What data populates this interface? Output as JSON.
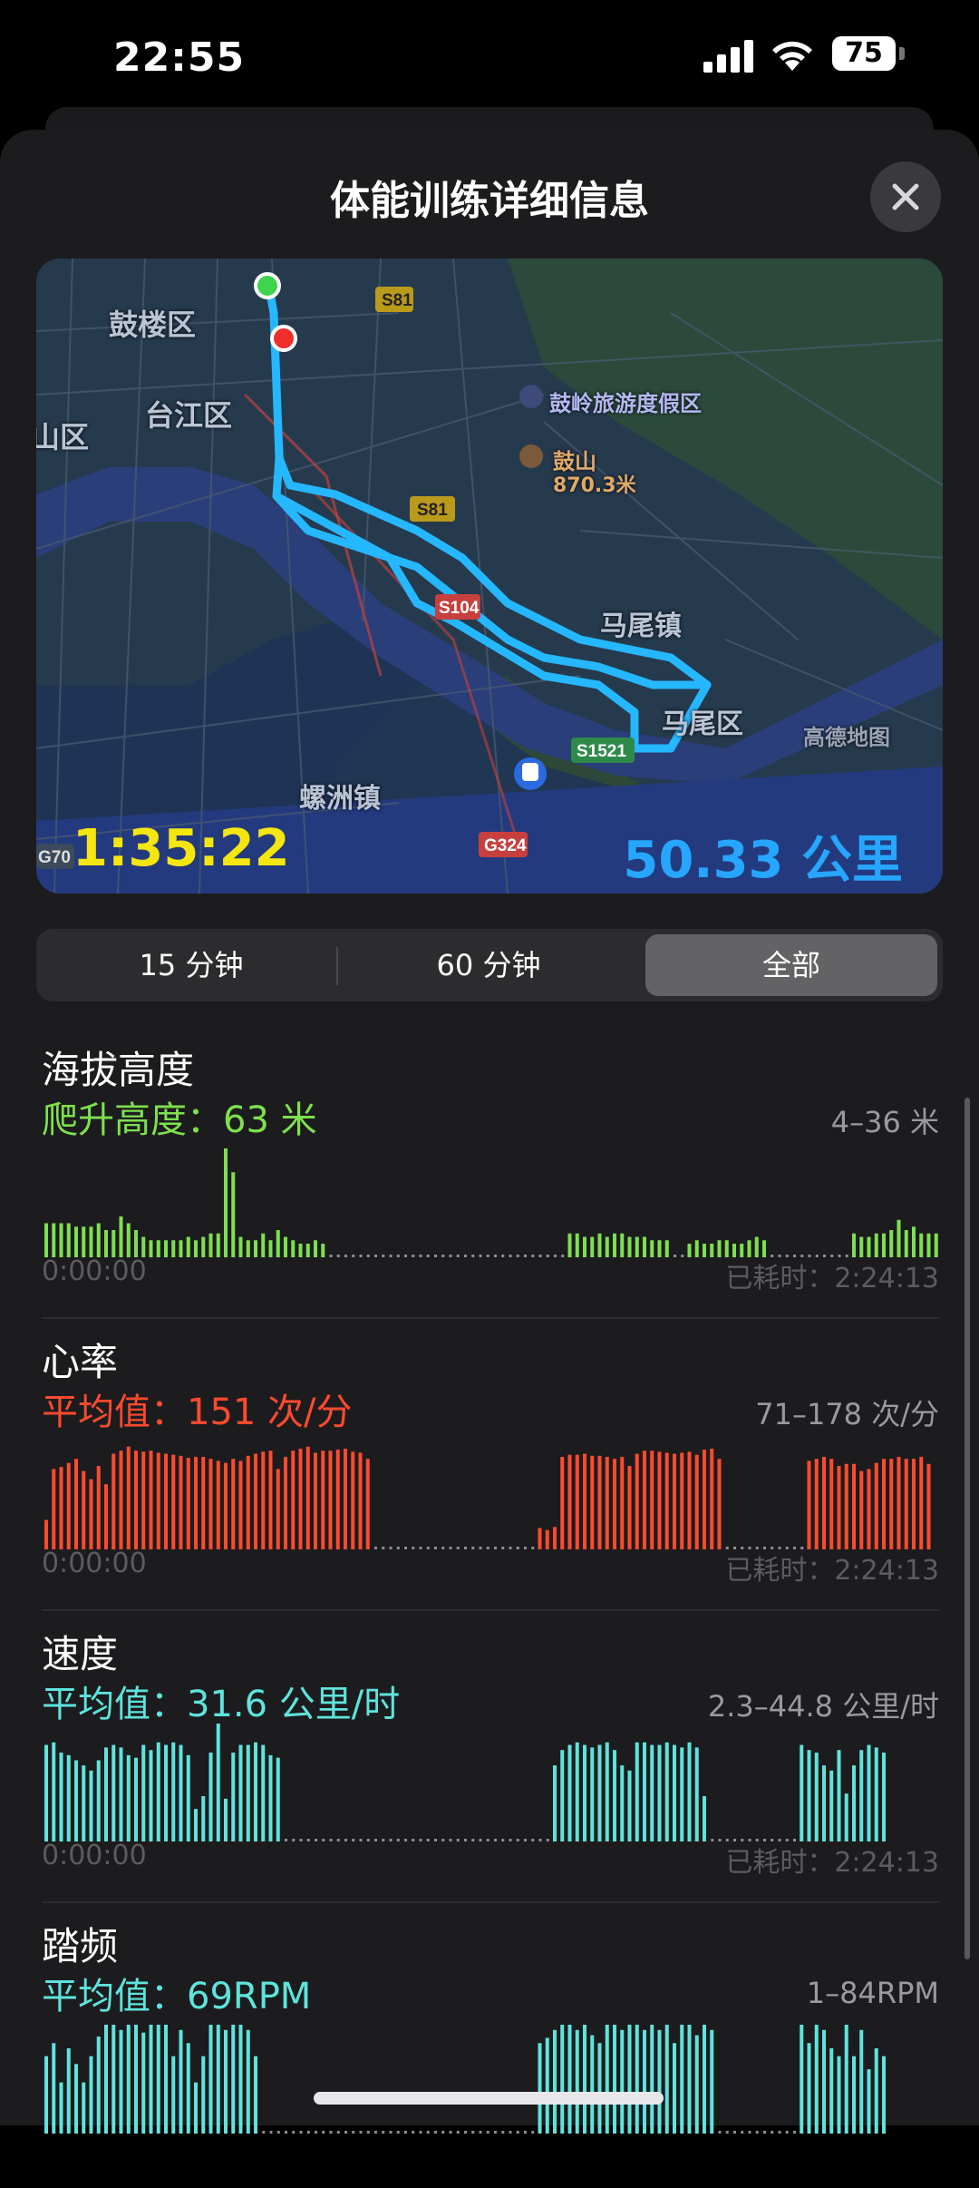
{
  "status_bar": {
    "time": "22:55",
    "battery": "75"
  },
  "sheet": {
    "title": "体能训练详细信息"
  },
  "map": {
    "labels": [
      {
        "text": "鼓楼区"
      },
      {
        "text": "台江区"
      },
      {
        "text": "山区"
      },
      {
        "text": "鼓岭旅游度假区"
      },
      {
        "text": "鼓山"
      },
      {
        "text": "870.3米"
      },
      {
        "text": "马尾镇"
      },
      {
        "text": "马尾区"
      },
      {
        "text": "螺洲镇"
      },
      {
        "text": "高德地图"
      }
    ],
    "road_badges": [
      "S81",
      "S81",
      "S104",
      "S1521",
      "G324",
      "G70"
    ],
    "duration": "1:35:22",
    "distance": "50.33 公里"
  },
  "segments": {
    "items": [
      "15 分钟",
      "60 分钟",
      "全部"
    ],
    "selected": "全部"
  },
  "metrics": [
    {
      "title": "海拔高度",
      "value": "爬升高度：63 米",
      "range": "4–36 米",
      "start": "0:00:00",
      "end": "已耗时：2:24:13",
      "color": "#7ee04e"
    },
    {
      "title": "心率",
      "value": "平均值：151 次/分",
      "range": "71–178 次/分",
      "start": "0:00:00",
      "end": "已耗时：2:24:13",
      "color": "#ff4a2e"
    },
    {
      "title": "速度",
      "value": "平均值：31.6 公里/时",
      "range": "2.3–44.8 公里/时",
      "start": "0:00:00",
      "end": "已耗时：2:24:13",
      "color": "#5ee4dc"
    },
    {
      "title": "踏频",
      "value": "平均值：69RPM",
      "range": "1–84RPM",
      "color": "#5ee4dc"
    }
  ],
  "chart_data": [
    {
      "type": "bar",
      "title": "海拔高度",
      "ylim": [
        4,
        36
      ],
      "segments": [
        {
          "from": 0,
          "values": [
            14,
            14,
            14,
            14,
            13,
            13,
            13,
            14,
            12,
            12,
            16,
            14,
            12,
            10,
            9,
            9,
            9,
            9,
            9,
            10,
            9,
            10,
            11,
            11,
            36,
            29,
            10,
            9,
            9,
            11,
            9,
            12,
            10,
            9,
            8,
            8,
            9,
            8
          ]
        },
        {
          "dots_to": 70
        },
        {
          "from": 70,
          "values": [
            11,
            11,
            10,
            10,
            11,
            10,
            11,
            11,
            10,
            10,
            10,
            9,
            9,
            9
          ]
        },
        {
          "dots_to": 86
        },
        {
          "from": 86,
          "values": [
            8,
            9,
            8,
            8,
            9,
            9,
            8,
            8,
            9,
            10,
            9
          ]
        },
        {
          "dots_to": 108
        },
        {
          "from": 108,
          "values": [
            11,
            10,
            10,
            11,
            11,
            12,
            15,
            12,
            13,
            11,
            11,
            11
          ]
        }
      ]
    },
    {
      "type": "bar",
      "title": "心率",
      "ylim": [
        71,
        178
      ],
      "segments": [
        {
          "from": 0,
          "values": [
            100,
            150,
            152,
            156,
            160,
            148,
            140,
            153,
            135,
            165,
            168,
            172,
            168,
            167,
            168,
            166,
            165,
            164,
            163,
            161,
            162,
            162,
            160,
            158,
            156,
            160,
            158,
            163,
            165,
            167,
            168,
            150,
            162,
            168,
            170,
            172,
            166,
            168,
            168,
            169,
            170,
            167,
            166,
            160
          ]
        },
        {
          "dots_to": 66
        },
        {
          "from": 66,
          "values": [
            92,
            90,
            93
          ]
        },
        {
          "dots_to": 69
        },
        {
          "from": 69,
          "values": [
            162,
            164,
            164,
            165,
            163,
            163,
            162,
            160,
            162,
            153,
            165,
            168,
            168,
            167,
            166,
            165,
            166,
            167,
            164,
            169,
            170,
            160
          ]
        },
        {
          "dots_to": 102
        },
        {
          "from": 102,
          "values": [
            158,
            160,
            162,
            160,
            153,
            155,
            155,
            148,
            150,
            156,
            160,
            160,
            162,
            160,
            160,
            162,
            155
          ]
        }
      ]
    },
    {
      "type": "bar",
      "title": "速度",
      "ylim": [
        2.3,
        44.8
      ],
      "segments": [
        {
          "from": 0,
          "values": [
            40,
            41,
            37,
            36,
            34,
            32,
            30,
            34,
            39,
            40,
            39,
            36,
            35,
            40,
            38,
            41,
            40,
            41,
            40,
            36,
            15,
            20,
            37,
            50,
            19,
            37,
            40,
            40,
            41,
            40,
            36,
            35
          ]
        },
        {
          "dots_to": 68
        },
        {
          "from": 68,
          "values": [
            32,
            38,
            40,
            41,
            40,
            39,
            40,
            41,
            38,
            32,
            30,
            41,
            41,
            40,
            40,
            41,
            40,
            39,
            41,
            39,
            20
          ]
        },
        {
          "dots_to": 101
        },
        {
          "from": 101,
          "values": [
            40,
            38,
            37,
            32,
            30,
            38,
            21,
            32,
            38,
            40,
            39,
            37
          ]
        }
      ]
    },
    {
      "type": "bar",
      "title": "踏频",
      "ylim": [
        1,
        84
      ],
      "segments": [
        {
          "from": 0,
          "values": [
            60,
            70,
            40,
            66,
            54,
            40,
            60,
            75,
            84,
            84,
            80,
            84,
            84,
            78,
            84,
            84,
            84,
            60,
            80,
            70,
            40,
            60,
            84,
            84,
            80,
            84,
            84,
            80,
            60
          ]
        },
        {
          "dots_to": 66
        },
        {
          "from": 66,
          "values": [
            70,
            74,
            80,
            84,
            84,
            80,
            84,
            76,
            70,
            84,
            84,
            80,
            84,
            84,
            80,
            84,
            80,
            84,
            70,
            84,
            84,
            76,
            84,
            80
          ]
        },
        {
          "dots_to": 101
        },
        {
          "from": 101,
          "values": [
            84,
            70,
            84,
            80,
            66,
            60,
            84,
            60,
            80,
            50,
            66,
            60
          ]
        }
      ]
    }
  ]
}
